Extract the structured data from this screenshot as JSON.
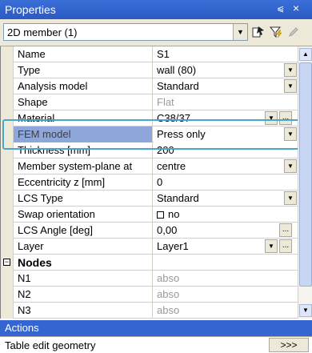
{
  "window": {
    "title": "Properties",
    "pin_glyph": "⩿",
    "close_glyph": "×"
  },
  "toolbar": {
    "combo_value": "2D member (1)",
    "icons": [
      "select-filter-icon",
      "funnel-lightning-icon",
      "pencil-icon"
    ]
  },
  "properties": [
    {
      "name": "Name",
      "value": "S1",
      "control": "none"
    },
    {
      "name": "Type",
      "value": "wall (80)",
      "control": "dropdown"
    },
    {
      "name": "Analysis model",
      "value": "Standard",
      "control": "dropdown"
    },
    {
      "name": "Shape",
      "value": "Flat",
      "control": "none",
      "gray": true
    },
    {
      "name": "Material",
      "value": "C38/37",
      "control": "dropdown+ellipsis"
    },
    {
      "name": "FEM model",
      "value": "Press only",
      "control": "dropdown",
      "selected": true
    },
    {
      "name": "Thickness [mm]",
      "value": "200",
      "control": "none"
    },
    {
      "name": "Member system-plane at",
      "value": "centre",
      "control": "dropdown"
    },
    {
      "name": "Eccentricity z [mm]",
      "value": "0",
      "control": "none"
    },
    {
      "name": "LCS Type",
      "value": "Standard",
      "control": "dropdown"
    },
    {
      "name": "Swap orientation",
      "value": "no",
      "control": "checkbox"
    },
    {
      "name": "LCS Angle [deg]",
      "value": "0,00",
      "control": "ellipsis"
    },
    {
      "name": "Layer",
      "value": "Layer1",
      "control": "dropdown+ellipsis"
    }
  ],
  "nodes_section": {
    "label": "Nodes",
    "items": [
      {
        "name": "N1",
        "value": "abso"
      },
      {
        "name": "N2",
        "value": "abso"
      },
      {
        "name": "N3",
        "value": "abso"
      }
    ]
  },
  "actions": {
    "header": "Actions",
    "item_label": "Table edit geometry",
    "button_label": ">>>"
  },
  "colors": {
    "titlebar": "#2a5ac2",
    "actions_header": "#3565d0",
    "selected_name_bg": "#8fa6da",
    "highlight_border": "#4aa6c8"
  }
}
